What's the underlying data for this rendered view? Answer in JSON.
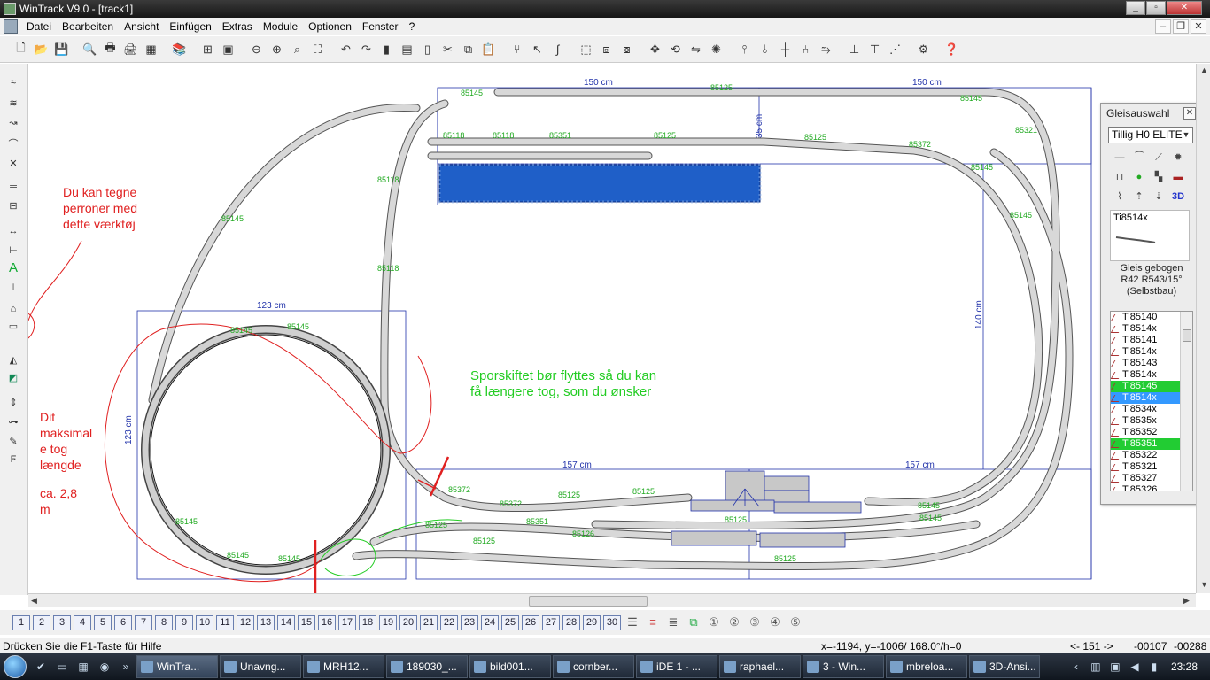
{
  "window": {
    "title": "WinTrack  V9.0 - [track1]"
  },
  "menu": [
    "Datei",
    "Bearbeiten",
    "Ansicht",
    "Einfügen",
    "Extras",
    "Module",
    "Optionen",
    "Fenster",
    "?"
  ],
  "canvas": {
    "dimensions": {
      "top_left": "150 cm",
      "top_right": "150 cm",
      "left_box": "123 cm",
      "left_box_side": "123 cm",
      "bottom_left": "157 cm",
      "bottom_right": "157 cm",
      "right_side": "140 cm",
      "station": "35 cm"
    },
    "track_labels": [
      "85145",
      "85125",
      "85145",
      "85118",
      "85118",
      "85351",
      "85125",
      "85125",
      "85372",
      "85321",
      "85145",
      "85145",
      "85118",
      "85118",
      "85145",
      "85145",
      "85145",
      "85145",
      "85372",
      "85125",
      "85125",
      "85351",
      "85126",
      "85125",
      "85125",
      "85145",
      "85145",
      "85125",
      "85372",
      "85125",
      "85145",
      "85145"
    ],
    "note_red_1": [
      "Du kan tegne",
      "perroner med",
      "dette værktøj"
    ],
    "note_red_2": [
      "Dit",
      "maksimal",
      "e tog",
      "længde",
      "",
      "ca. 2,8",
      "m"
    ],
    "note_green": [
      "Sporskiftet bør flyttes så du kan",
      "få længere tog, som du ønsker"
    ]
  },
  "panel": {
    "title": "Gleisauswahl",
    "system": "Tillig H0 ELITE",
    "preview_label": "Ti8514x",
    "description": [
      "Gleis gebogen",
      "R42 R543/15°",
      "(Selbstbau)"
    ],
    "items": [
      {
        "label": "Ti85140",
        "state": "normal"
      },
      {
        "label": "Ti8514x",
        "state": "normal"
      },
      {
        "label": "Ti85141",
        "state": "normal"
      },
      {
        "label": "Ti8514x",
        "state": "normal"
      },
      {
        "label": "Ti85143",
        "state": "normal"
      },
      {
        "label": "Ti8514x",
        "state": "normal"
      },
      {
        "label": "Ti85145",
        "state": "green"
      },
      {
        "label": "Ti8514x",
        "state": "blue"
      },
      {
        "label": "Ti8534x",
        "state": "normal"
      },
      {
        "label": "Ti8535x",
        "state": "normal"
      },
      {
        "label": "Ti85352",
        "state": "normal"
      },
      {
        "label": "Ti85351",
        "state": "green"
      },
      {
        "label": "Ti85322",
        "state": "normal"
      },
      {
        "label": "Ti85321",
        "state": "normal"
      },
      {
        "label": "Ti85327",
        "state": "normal"
      },
      {
        "label": "Ti85326",
        "state": "normal"
      }
    ]
  },
  "pages": [
    "1",
    "2",
    "3",
    "4",
    "5",
    "6",
    "7",
    "8",
    "9",
    "10",
    "11",
    "12",
    "13",
    "14",
    "15",
    "16",
    "17",
    "18",
    "19",
    "20",
    "21",
    "22",
    "23",
    "24",
    "25",
    "26",
    "27",
    "28",
    "29",
    "30"
  ],
  "status": {
    "help": "Drücken Sie die  F1-Taste für Hilfe",
    "coords": "x=-1194, y=-1006/ 168.0°/h=0",
    "nav": "<- 151 ->",
    "val1": "-00107",
    "val2": "-00288"
  },
  "taskbar": {
    "tasks": [
      "WinTra...",
      "Unavng...",
      "MRH12...",
      "189030_...",
      "bild001...",
      "cornber...",
      "iDE 1 - ...",
      "raphael...",
      "3 - Win...",
      "mbreloa...",
      "3D-Ansi..."
    ],
    "clock": "23:28"
  },
  "colors": {
    "track": "#d0d0d0",
    "label_green": "#22aa22",
    "annotation_red": "#e02020",
    "dimension_blue": "#2233aa",
    "water": "#1f5fc8"
  }
}
